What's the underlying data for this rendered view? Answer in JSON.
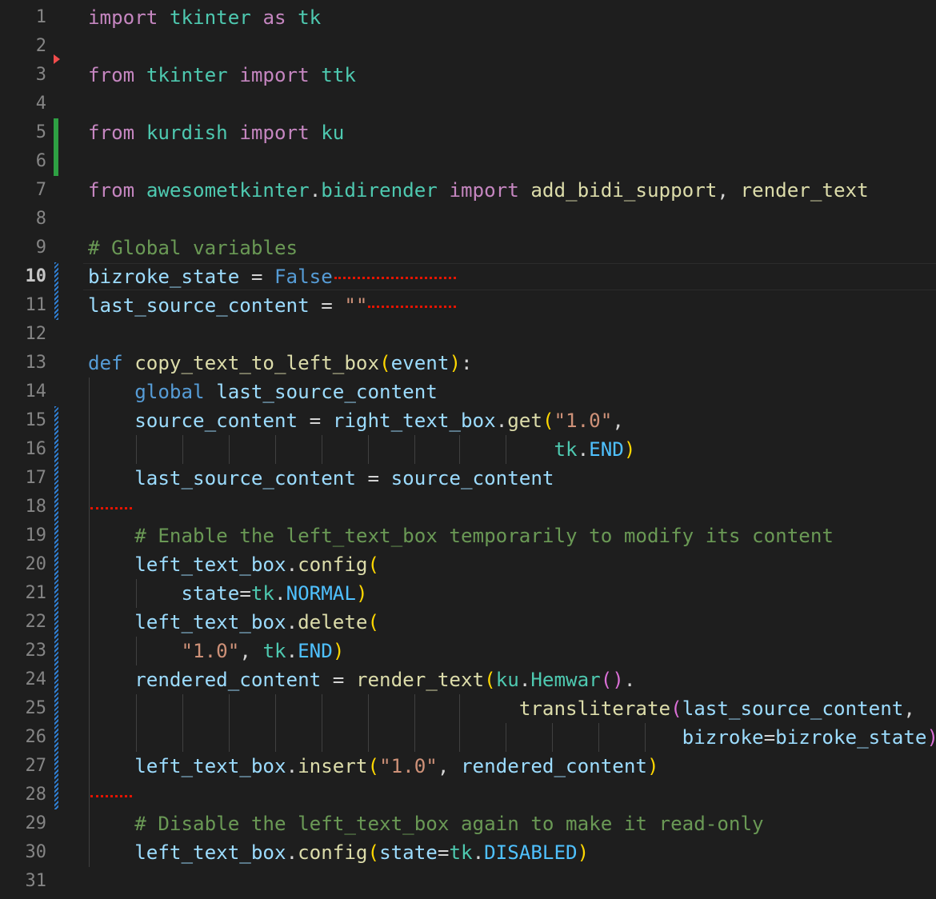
{
  "editor": {
    "language": "python",
    "theme": "dark",
    "current_line": 10,
    "line_numbers": [
      "1",
      "2",
      "3",
      "4",
      "5",
      "6",
      "7",
      "8",
      "9",
      "10",
      "11",
      "12",
      "13",
      "14",
      "15",
      "16",
      "17",
      "18",
      "19",
      "20",
      "21",
      "22",
      "23",
      "24",
      "25",
      "26",
      "27",
      "28",
      "29",
      "30",
      "31"
    ],
    "lines": [
      [
        [
          "kw",
          "import"
        ],
        [
          "op",
          " "
        ],
        [
          "mod",
          "tkinter"
        ],
        [
          "op",
          " "
        ],
        [
          "kw",
          "as"
        ],
        [
          "op",
          " "
        ],
        [
          "mod",
          "tk"
        ]
      ],
      [],
      [
        [
          "kw",
          "from"
        ],
        [
          "op",
          " "
        ],
        [
          "mod",
          "tkinter"
        ],
        [
          "op",
          " "
        ],
        [
          "kw",
          "import"
        ],
        [
          "op",
          " "
        ],
        [
          "mod",
          "ttk"
        ]
      ],
      [],
      [
        [
          "kw",
          "from"
        ],
        [
          "op",
          " "
        ],
        [
          "mod",
          "kurdish"
        ],
        [
          "op",
          " "
        ],
        [
          "kw",
          "import"
        ],
        [
          "op",
          " "
        ],
        [
          "mod",
          "ku"
        ]
      ],
      [],
      [
        [
          "kw",
          "from"
        ],
        [
          "op",
          " "
        ],
        [
          "mod",
          "awesometkinter"
        ],
        [
          "op",
          "."
        ],
        [
          "mod",
          "bidirender"
        ],
        [
          "op",
          " "
        ],
        [
          "kw",
          "import"
        ],
        [
          "op",
          " "
        ],
        [
          "fn",
          "add_bidi_support"
        ],
        [
          "op",
          ", "
        ],
        [
          "fn",
          "render_text"
        ]
      ],
      [],
      [
        [
          "cmt",
          "# Global variables"
        ]
      ],
      [
        [
          "var",
          "bizroke_state"
        ],
        [
          "op",
          " = "
        ],
        [
          "def",
          "False"
        ]
      ],
      [
        [
          "var",
          "last_source_content"
        ],
        [
          "op",
          " = "
        ],
        [
          "str",
          "\"\""
        ]
      ],
      [],
      [
        [
          "def",
          "def"
        ],
        [
          "op",
          " "
        ],
        [
          "fn",
          "copy_text_to_left_box"
        ],
        [
          "p1",
          "("
        ],
        [
          "var",
          "event"
        ],
        [
          "p1",
          ")"
        ],
        [
          "op",
          ":"
        ]
      ],
      [
        [
          "op",
          "    "
        ],
        [
          "def",
          "global"
        ],
        [
          "op",
          " "
        ],
        [
          "var",
          "last_source_content"
        ]
      ],
      [
        [
          "op",
          "    "
        ],
        [
          "var",
          "source_content"
        ],
        [
          "op",
          " = "
        ],
        [
          "var",
          "right_text_box"
        ],
        [
          "op",
          "."
        ],
        [
          "fn",
          "get"
        ],
        [
          "p1",
          "("
        ],
        [
          "str",
          "\"1.0\""
        ],
        [
          "op",
          ","
        ]
      ],
      [
        [
          "op",
          "                                        "
        ],
        [
          "mod",
          "tk"
        ],
        [
          "op",
          "."
        ],
        [
          "const",
          "END"
        ],
        [
          "p1",
          ")"
        ]
      ],
      [
        [
          "op",
          "    "
        ],
        [
          "var",
          "last_source_content"
        ],
        [
          "op",
          " = "
        ],
        [
          "var",
          "source_content"
        ]
      ],
      [],
      [
        [
          "op",
          "    "
        ],
        [
          "cmt",
          "# Enable the left_text_box temporarily to modify its content"
        ]
      ],
      [
        [
          "op",
          "    "
        ],
        [
          "var",
          "left_text_box"
        ],
        [
          "op",
          "."
        ],
        [
          "fn",
          "config"
        ],
        [
          "p1",
          "("
        ]
      ],
      [
        [
          "op",
          "        "
        ],
        [
          "var",
          "state"
        ],
        [
          "op",
          "="
        ],
        [
          "mod",
          "tk"
        ],
        [
          "op",
          "."
        ],
        [
          "const",
          "NORMAL"
        ],
        [
          "p1",
          ")"
        ]
      ],
      [
        [
          "op",
          "    "
        ],
        [
          "var",
          "left_text_box"
        ],
        [
          "op",
          "."
        ],
        [
          "fn",
          "delete"
        ],
        [
          "p1",
          "("
        ]
      ],
      [
        [
          "op",
          "        "
        ],
        [
          "str",
          "\"1.0\""
        ],
        [
          "op",
          ", "
        ],
        [
          "mod",
          "tk"
        ],
        [
          "op",
          "."
        ],
        [
          "const",
          "END"
        ],
        [
          "p1",
          ")"
        ]
      ],
      [
        [
          "op",
          "    "
        ],
        [
          "var",
          "rendered_content"
        ],
        [
          "op",
          " = "
        ],
        [
          "fn",
          "render_text"
        ],
        [
          "p1",
          "("
        ],
        [
          "mod",
          "ku"
        ],
        [
          "op",
          "."
        ],
        [
          "mod",
          "Hemwar"
        ],
        [
          "p2",
          "()"
        ],
        [
          "op",
          "."
        ]
      ],
      [
        [
          "op",
          "                                     "
        ],
        [
          "fn",
          "transliterate"
        ],
        [
          "p2",
          "("
        ],
        [
          "var",
          "last_source_content"
        ],
        [
          "op",
          ","
        ]
      ],
      [
        [
          "op",
          "                                                   "
        ],
        [
          "var",
          "bizroke"
        ],
        [
          "op",
          "="
        ],
        [
          "var",
          "bizroke_state"
        ],
        [
          "p2",
          ")"
        ],
        [
          "p1",
          ")"
        ]
      ],
      [
        [
          "op",
          "    "
        ],
        [
          "var",
          "left_text_box"
        ],
        [
          "op",
          "."
        ],
        [
          "fn",
          "insert"
        ],
        [
          "p1",
          "("
        ],
        [
          "str",
          "\"1.0\""
        ],
        [
          "op",
          ", "
        ],
        [
          "var",
          "rendered_content"
        ],
        [
          "p1",
          ")"
        ]
      ],
      [],
      [
        [
          "op",
          "    "
        ],
        [
          "cmt",
          "# Disable the left_text_box again to make it read-only"
        ]
      ],
      [
        [
          "op",
          "    "
        ],
        [
          "var",
          "left_text_box"
        ],
        [
          "op",
          "."
        ],
        [
          "fn",
          "config"
        ],
        [
          "p1",
          "("
        ],
        [
          "var",
          "state"
        ],
        [
          "op",
          "="
        ],
        [
          "mod",
          "tk"
        ],
        [
          "op",
          "."
        ],
        [
          "const",
          "DISABLED"
        ],
        [
          "p1",
          ")"
        ]
      ],
      []
    ]
  },
  "colors": {
    "background": "#1e1e1e",
    "line_number": "#858585",
    "added_gutter": "#2ea043",
    "modified_gutter": "#2f7fd4",
    "error_squiggle": "#e51400"
  }
}
